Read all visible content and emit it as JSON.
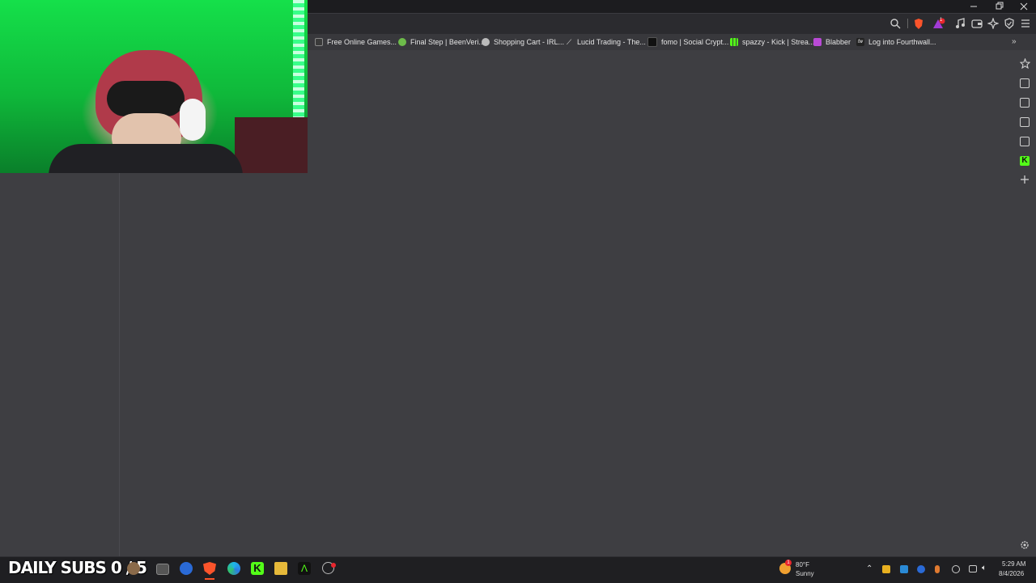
{
  "bookmarks": [
    {
      "label": "Free Online Games...",
      "icon": "games-icon"
    },
    {
      "label": "Final Step | BeenVeri...",
      "icon": "beenverified-icon"
    },
    {
      "label": "Shopping Cart - IRL...",
      "icon": "globe-icon"
    },
    {
      "label": "Lucid Trading - The...",
      "icon": "lucid-icon"
    },
    {
      "label": "fomo | Social Crypt...",
      "icon": "fomo-icon"
    },
    {
      "label": "spazzy - Kick | Strea...",
      "icon": "kick-icon"
    },
    {
      "label": "Blabber",
      "icon": "blabber-icon"
    },
    {
      "label": "Log into Fourthwall...",
      "icon": "fourthwall-icon"
    }
  ],
  "toolbar": {
    "brave_badge_count": "1"
  },
  "overlay": {
    "daily_subs": "DAILY SUBS 0 / 5"
  },
  "weather": {
    "temp": "80°F",
    "condition": "Sunny",
    "badge": "1"
  },
  "clock": {
    "time": "5:29 AM",
    "date": "8/4/2026"
  },
  "colors": {
    "accent_green": "#53fc18",
    "brave_orange": "#fb542b",
    "bg": "#3e3e42"
  }
}
